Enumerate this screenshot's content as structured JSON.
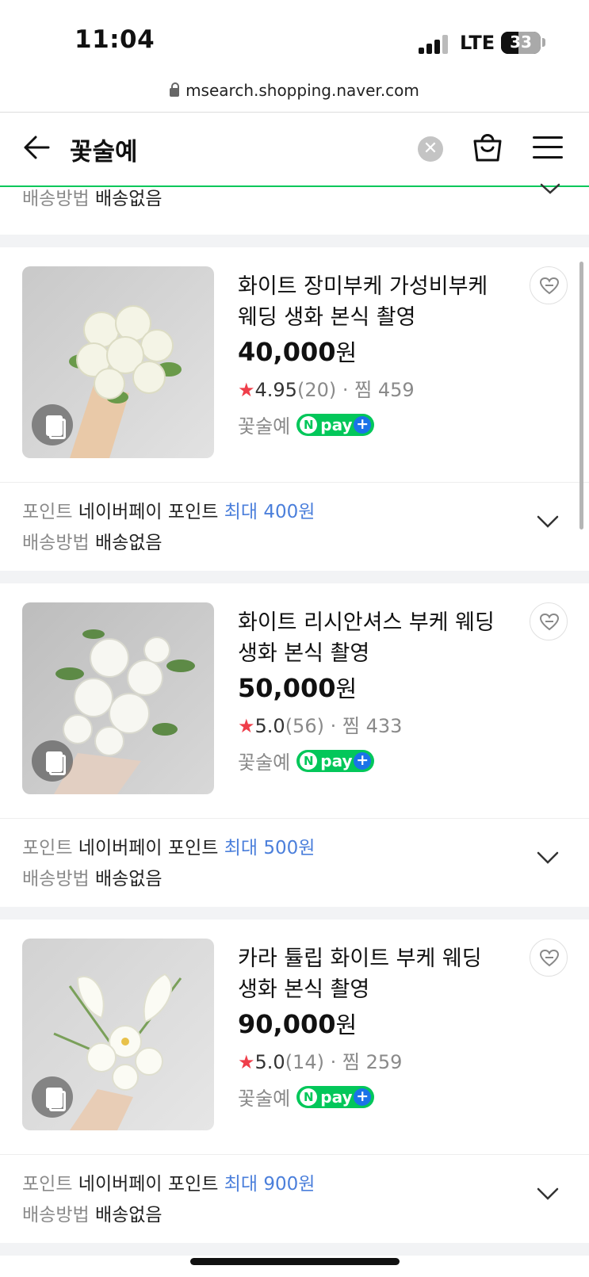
{
  "status_bar": {
    "time": "11:04",
    "network": "LTE",
    "battery": "33"
  },
  "browser": {
    "url": "msearch.shopping.naver.com"
  },
  "header": {
    "title": "꽃술예"
  },
  "top_row": {
    "shipping_label": "배송방법",
    "shipping_value": "배송없음"
  },
  "products": [
    {
      "name": "화이트 장미부케 가성비부케 웨딩 생화 본식 촬영",
      "price": "40,000",
      "currency": "원",
      "rating": "4.95",
      "review_count": "(20)",
      "wish_label": "찜",
      "wish_count": "459",
      "seller": "꽃술예",
      "npay": "pay",
      "point_label": "포인트",
      "point_text": "네이버페이 포인트",
      "point_max": "최대 400원",
      "shipping_label": "배송방법",
      "shipping_value": "배송없음"
    },
    {
      "name": "화이트 리시안셔스 부케 웨딩 생화 본식 촬영",
      "price": "50,000",
      "currency": "원",
      "rating": "5.0",
      "review_count": "(56)",
      "wish_label": "찜",
      "wish_count": "433",
      "seller": "꽃술예",
      "npay": "pay",
      "point_label": "포인트",
      "point_text": "네이버페이 포인트",
      "point_max": "최대 500원",
      "shipping_label": "배송방법",
      "shipping_value": "배송없음"
    },
    {
      "name": "카라 튤립 화이트 부케 웨딩 생화 본식 촬영",
      "price": "90,000",
      "currency": "원",
      "rating": "5.0",
      "review_count": "(14)",
      "wish_label": "찜",
      "wish_count": "259",
      "seller": "꽃술예",
      "npay": "pay",
      "point_label": "포인트",
      "point_text": "네이버페이 포인트",
      "point_max": "최대 900원",
      "shipping_label": "배송방법",
      "shipping_value": "배송없음"
    }
  ],
  "colors": {
    "accent_green": "#03c75a",
    "point_blue": "#4b7fdb",
    "star_red": "#ef3e4a"
  }
}
